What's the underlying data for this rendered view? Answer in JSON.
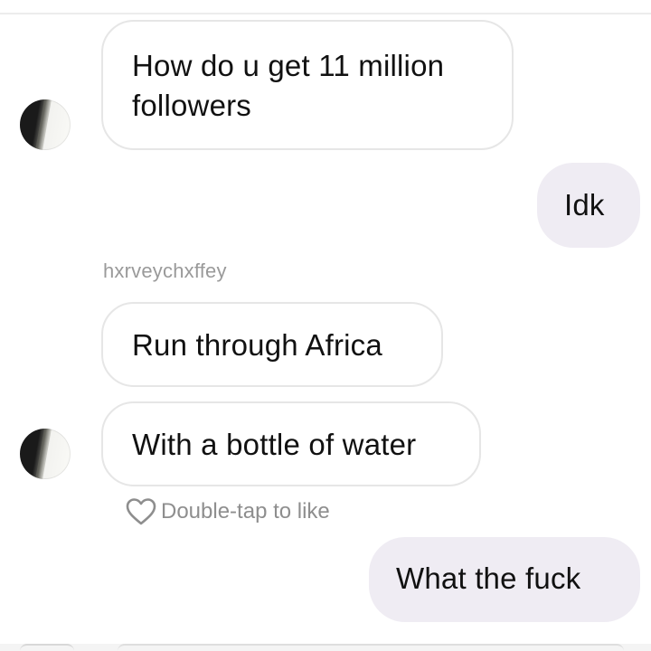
{
  "conversation": {
    "messages": [
      {
        "direction": "incoming",
        "text": "How do u get 11 million followers"
      },
      {
        "direction": "outgoing",
        "text": "Idk"
      },
      {
        "direction": "incoming",
        "text": "Run through Africa"
      },
      {
        "direction": "incoming",
        "text": "With a bottle of water"
      },
      {
        "direction": "outgoing",
        "text": "What the fuck"
      }
    ],
    "sender_username": "hxrveychxffey",
    "like_hint": "Double-tap to like"
  },
  "icons": {
    "like": "heart-outline-icon"
  },
  "colors": {
    "outgoing_bubble": "#efecf3",
    "incoming_border": "#e6e6e6",
    "meta_text": "#8e8e8e"
  }
}
